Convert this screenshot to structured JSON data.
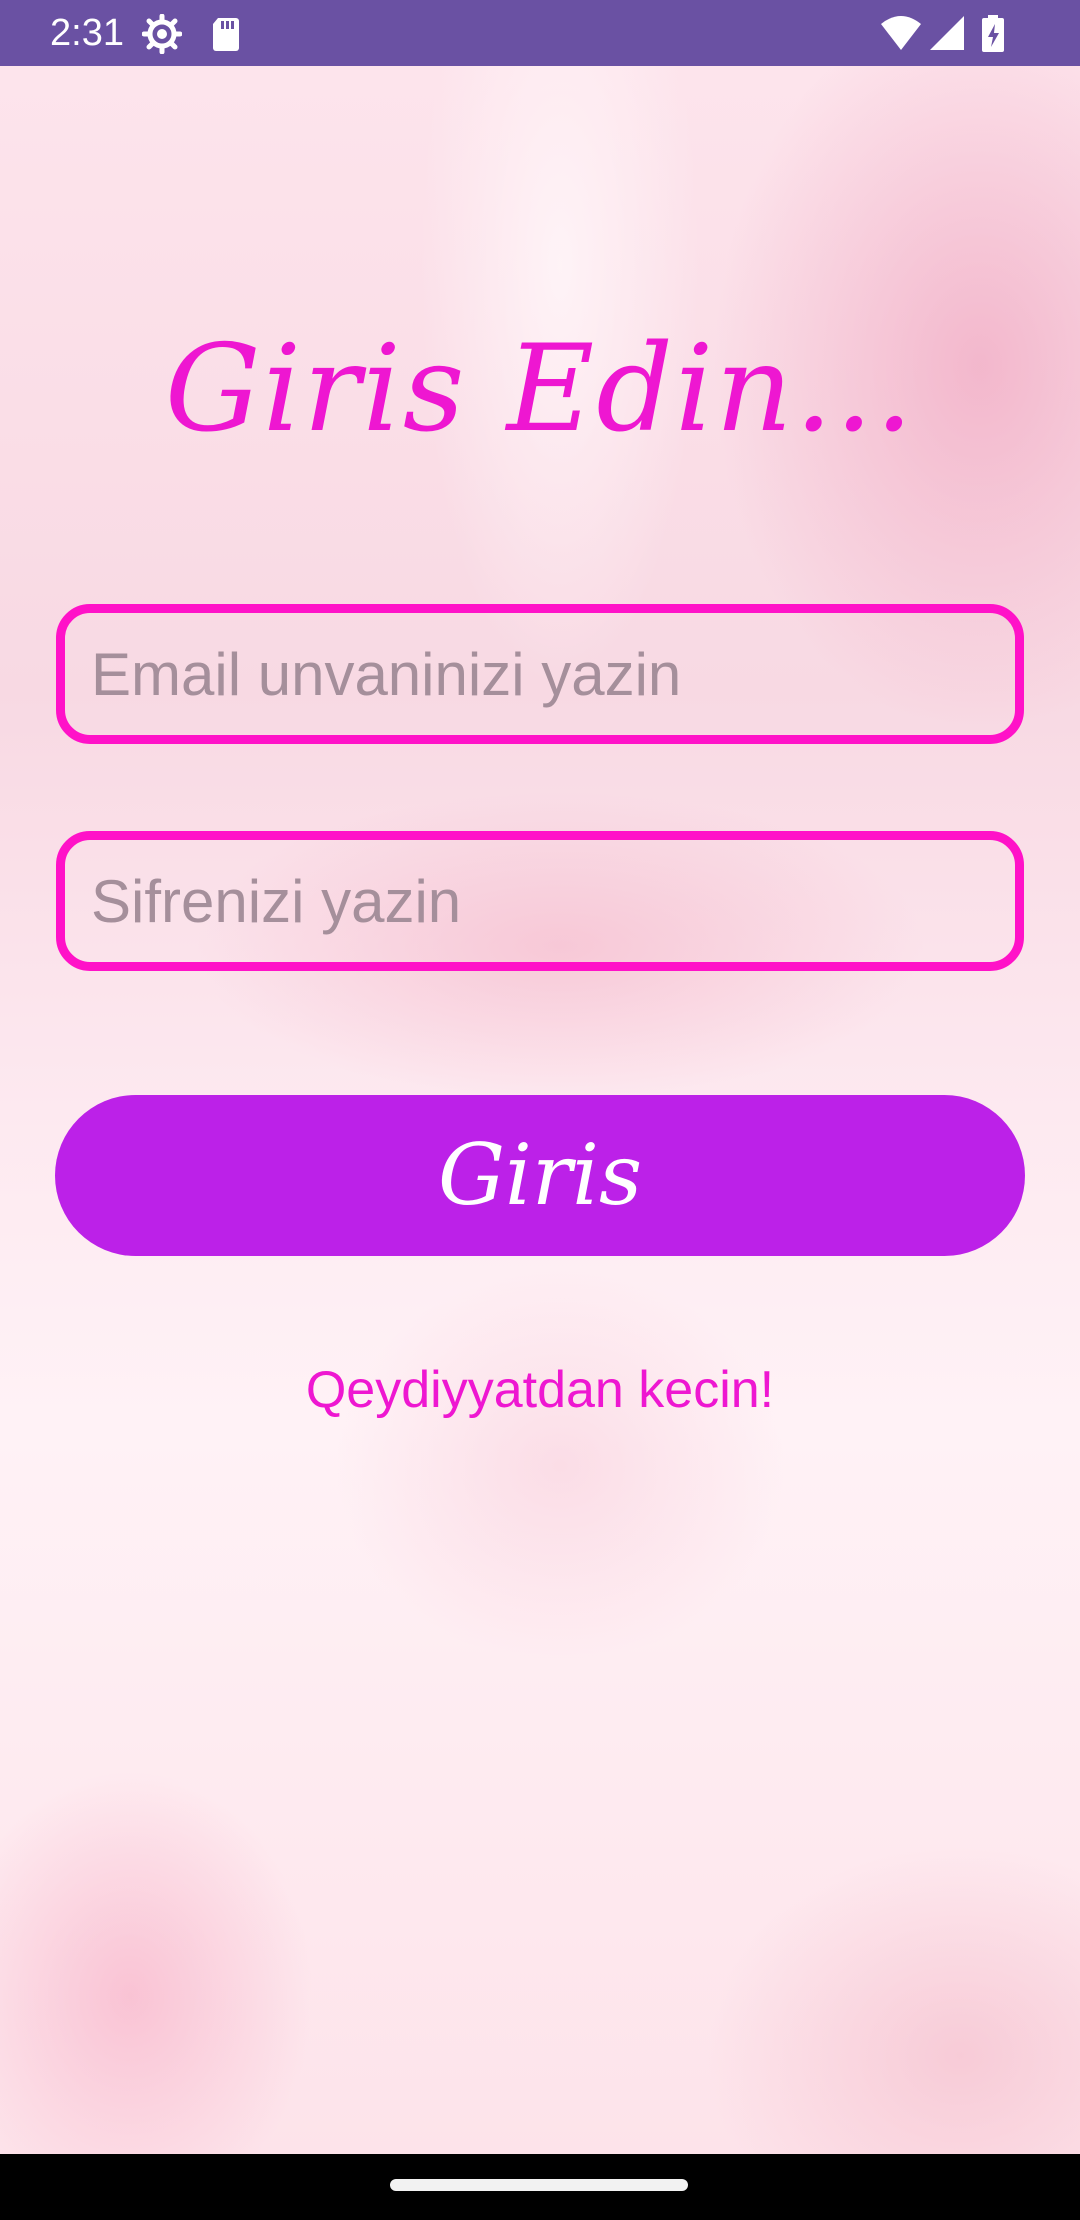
{
  "status_bar": {
    "time": "2:31",
    "background_color": "#6a51a3",
    "left_icons": [
      "gear-icon",
      "sd-card-icon"
    ],
    "right_icons": [
      "wifi-icon",
      "cell-signal-icon",
      "battery-charging-icon"
    ]
  },
  "login": {
    "title": "Giris Edin...",
    "email_placeholder": "Email unvaninizi yazin",
    "password_placeholder": "Sifrenizi yazin",
    "button_label": "Giris",
    "register_link": "Qeydiyyatdan kecin!"
  },
  "colors": {
    "accent_pink": "#ee17d1",
    "input_border": "#ff12c8",
    "button_purple": "#bc21e8",
    "placeholder": "#a58f9b"
  }
}
